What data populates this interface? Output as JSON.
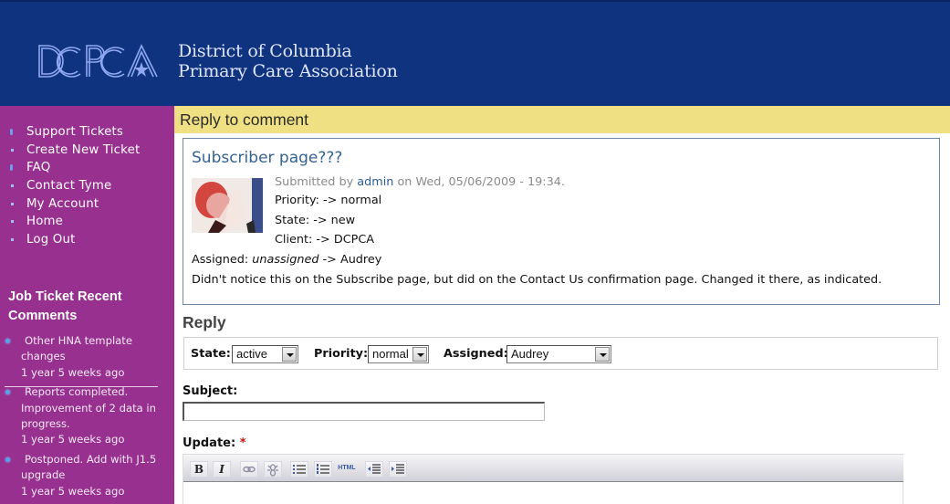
{
  "header": {
    "logo_text": "DCPCA",
    "site_name_line1": "District of Columbia",
    "site_name_line2": "Primary Care Association",
    "colors": {
      "header_bg": "#10337f",
      "sidebar_bg": "#97308f",
      "title_bar_bg": "#f0e084",
      "link": "#346294"
    }
  },
  "sidebar": {
    "nav": [
      {
        "label": "Support Tickets",
        "icon": "arrow-bullet-icon"
      },
      {
        "label": "Create New Ticket",
        "icon": "square-bullet-icon"
      },
      {
        "label": "FAQ",
        "icon": "arrow-bullet-icon"
      },
      {
        "label": "Contact Tyme",
        "icon": "square-bullet-icon"
      },
      {
        "label": "My Account",
        "icon": "square-bullet-icon"
      },
      {
        "label": "Home",
        "icon": "square-bullet-icon"
      },
      {
        "label": "Log Out",
        "icon": "square-bullet-icon"
      }
    ],
    "recent_block": {
      "title": "Job Ticket Recent Comments",
      "items": [
        {
          "title": "Other HNA template changes",
          "ago": "1 year 5 weeks ago"
        },
        {
          "title": "Reports completed. Improvement of 2 data in progress.",
          "ago": "1 year 5 weeks ago"
        },
        {
          "title": "Postponed. Add with J1.5 upgrade",
          "ago": "1 year 5 weeks ago"
        }
      ]
    }
  },
  "main": {
    "page_title": "Reply to comment",
    "comment": {
      "title": "Subscriber page???",
      "submitted_prefix": "Submitted by",
      "author": "admin",
      "submitted_suffix": "on Wed, 05/06/2009 - 19:34.",
      "priority_change": "Priority: -> normal",
      "state_change": "State: -> new",
      "client_change": "Client: -> DCPCA",
      "assigned_label": "Assigned:",
      "assigned_from": "unassigned",
      "assigned_to": "-> Audrey",
      "body": "Didn't notice this on the Subscribe page, but did on the Contact Us confirmation page. Changed it there, as indicated."
    },
    "reply": {
      "heading": "Reply",
      "state_label": "State:",
      "state_value": "active",
      "priority_label": "Priority:",
      "priority_value": "normal",
      "assigned_label": "Assigned:",
      "assigned_value": "Audrey",
      "subject_label": "Subject:",
      "subject_value": "",
      "update_label": "Update:",
      "required_mark": "*",
      "toolbar": {
        "bold": "B",
        "italic": "I",
        "html": "HTML"
      }
    }
  }
}
